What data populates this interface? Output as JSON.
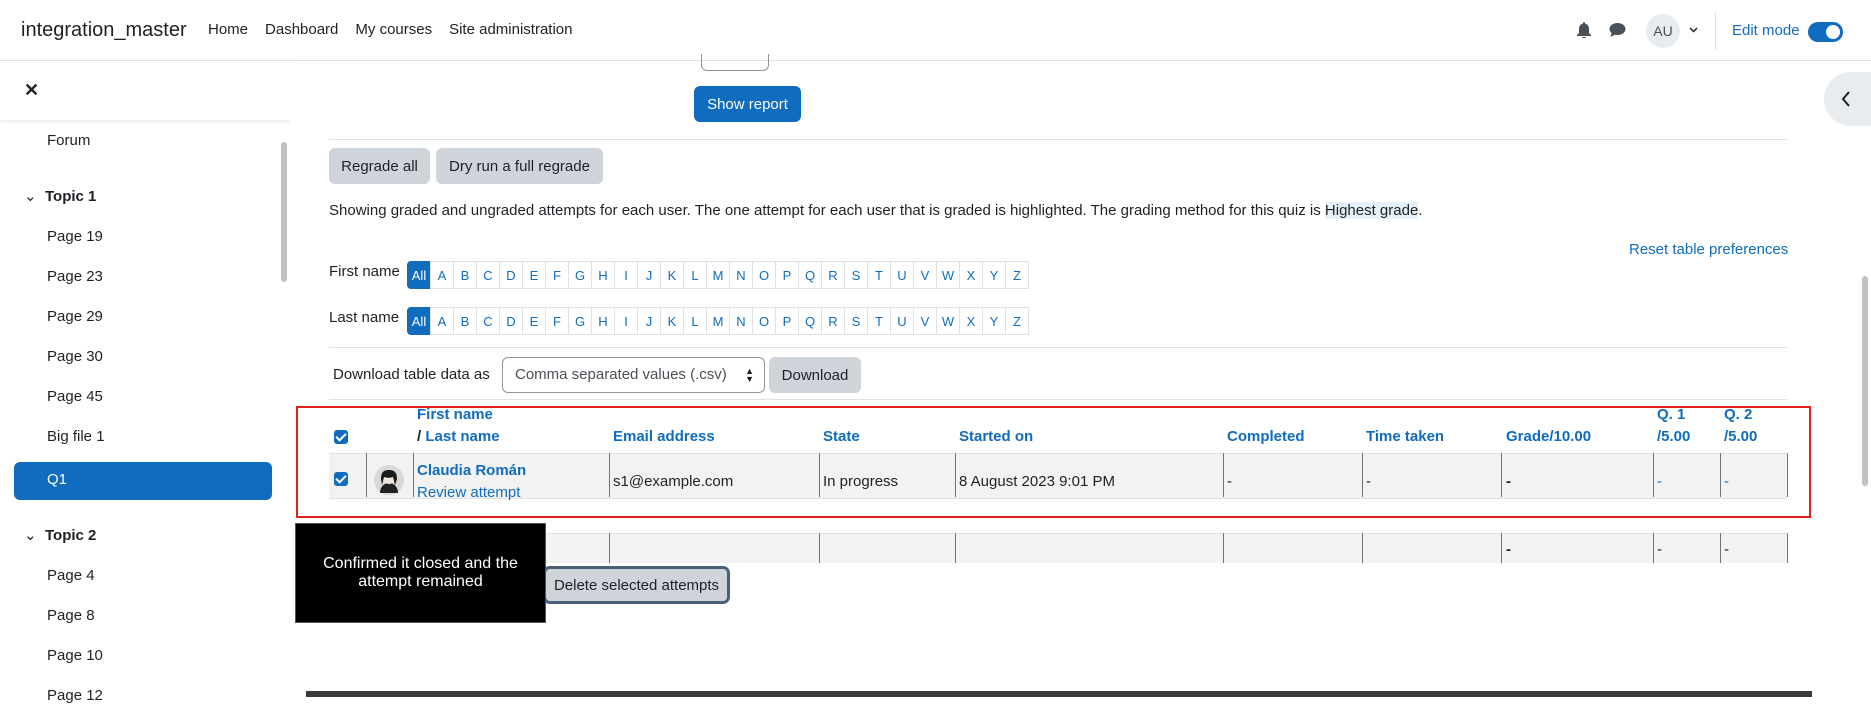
{
  "navbar": {
    "brand": "integration_master",
    "links": [
      "Home",
      "Dashboard",
      "My courses",
      "Site administration"
    ],
    "avatar_initials": "AU",
    "edit_mode_label": "Edit mode"
  },
  "drawer": {
    "items": [
      {
        "label": "Forum",
        "type": "item"
      },
      {
        "label": "Topic 1",
        "type": "section"
      },
      {
        "label": "Page 19",
        "type": "item"
      },
      {
        "label": "Page 23",
        "type": "item"
      },
      {
        "label": "Page 29",
        "type": "item"
      },
      {
        "label": "Page 30",
        "type": "item"
      },
      {
        "label": "Page 45",
        "type": "item"
      },
      {
        "label": "Big file 1",
        "type": "item"
      },
      {
        "label": "Q1",
        "type": "active"
      },
      {
        "label": "Topic 2",
        "type": "section"
      },
      {
        "label": "Page 4",
        "type": "item"
      },
      {
        "label": "Page 8",
        "type": "item"
      },
      {
        "label": "Page 10",
        "type": "item"
      },
      {
        "label": "Page 12",
        "type": "item"
      }
    ]
  },
  "main": {
    "show_report": "Show report",
    "regrade_all": "Regrade all",
    "dry_run": "Dry run a full regrade",
    "info_text": "Showing graded and ungraded attempts for each user. The one attempt for each user that is graded is highlighted. The grading method for this quiz is ",
    "info_highlight": "Highest grade",
    "info_end": ".",
    "reset_prefs": "Reset table preferences",
    "first_name_label": "First name",
    "last_name_label": "Last name",
    "initials": [
      "All",
      "A",
      "B",
      "C",
      "D",
      "E",
      "F",
      "G",
      "H",
      "I",
      "J",
      "K",
      "L",
      "M",
      "N",
      "O",
      "P",
      "Q",
      "R",
      "S",
      "T",
      "U",
      "V",
      "W",
      "X",
      "Y",
      "Z"
    ],
    "download_label": "Download table data as",
    "download_format": "Comma separated values (.csv)",
    "download_button": "Download"
  },
  "table": {
    "headers": {
      "first_name": "First name",
      "slash": "/",
      "last_name": "Last name",
      "email": "Email address",
      "state": "State",
      "started": "Started on",
      "completed": "Completed",
      "time_taken": "Time taken",
      "grade": "Grade/10.00",
      "q1": "Q. 1",
      "q1_max": "/5.00",
      "q2": "Q. 2",
      "q2_max": "/5.00"
    },
    "row": {
      "name": "Claudia Román",
      "review": "Review attempt",
      "email": "s1@example.com",
      "state": "In progress",
      "started": "8 August 2023 9:01 PM",
      "completed": "-",
      "time_taken": "-",
      "grade": "-",
      "q1": "-",
      "q2": "-"
    },
    "row2": {
      "grade": "-",
      "q1": "-",
      "q2": "-"
    }
  },
  "tooltip": "Confirmed it closed and the attempt remained",
  "delete_button": "Delete selected attempts"
}
